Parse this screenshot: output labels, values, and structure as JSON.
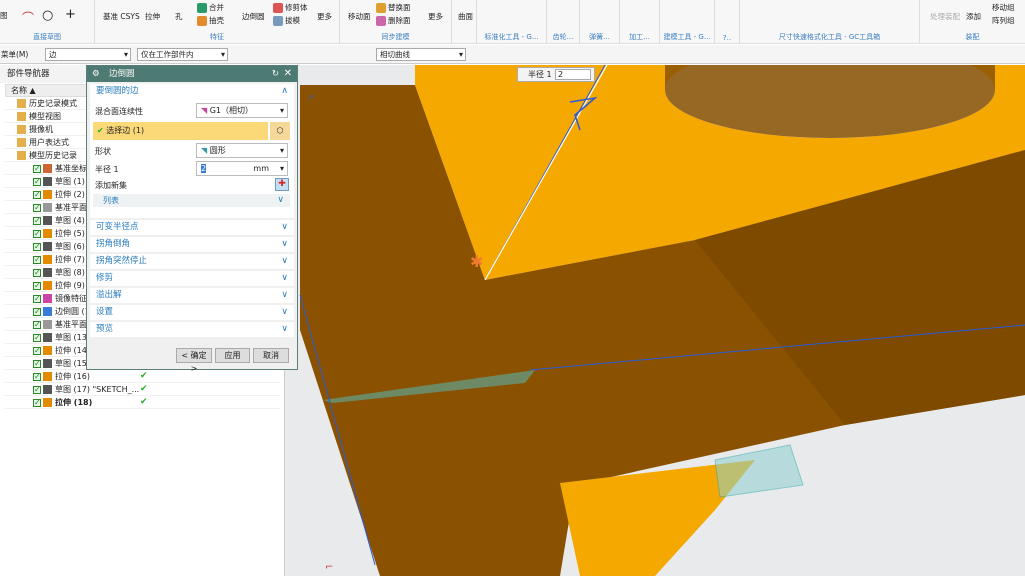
{
  "ribbon": {
    "groups": [
      {
        "label": "直接草图"
      },
      {
        "label": "特征"
      },
      {
        "label": "同步建模"
      },
      {
        "label": "标准化工具 - G..."
      },
      {
        "label": "齿轮..."
      },
      {
        "label": "弹簧..."
      },
      {
        "label": "加工..."
      },
      {
        "label": "建模工具 - G..."
      },
      {
        "label": "?.."
      },
      {
        "label": "尺寸快速格式化工具 - GC工具箱"
      },
      {
        "label": "装配"
      }
    ],
    "buttons": {
      "sketch": "图",
      "csys": "基准 CSYS",
      "extrude": "拉伸",
      "hole": "孔",
      "unite": "合并",
      "shell": "抽壳",
      "edge_blend": "边倒圆",
      "trim_body": "修剪体",
      "draft": "拔模",
      "more1": "更多",
      "move_face": "移动面",
      "replace_face": "替换面",
      "delete_face": "删除面",
      "more2": "更多",
      "surface": "曲面",
      "process_asm": "处理装配",
      "add": "添加",
      "move_comp": "移动组",
      "array_comp": "阵列组"
    }
  },
  "toolbar": {
    "menu": "菜单(M)",
    "filter": "边",
    "scope": "仅在工作部件内",
    "curve_rule": "相切曲线"
  },
  "navigator": {
    "title": "部件导航器",
    "column_name": "名称",
    "items": [
      {
        "label": "历史记录模式",
        "level": 0,
        "check": false
      },
      {
        "label": "模型视图",
        "level": 0,
        "check": false
      },
      {
        "label": "摄像机",
        "level": 0,
        "check": false
      },
      {
        "label": "用户表达式",
        "level": 0,
        "check": false
      },
      {
        "label": "模型历史记录",
        "level": 0,
        "check": false
      },
      {
        "label": "基准坐标",
        "level": 1,
        "check": true,
        "icon": "csys"
      },
      {
        "label": "草图 (1)",
        "level": 1,
        "check": true,
        "icon": "sketch"
      },
      {
        "label": "拉伸 (2)",
        "level": 1,
        "check": true,
        "icon": "extrude"
      },
      {
        "label": "基准平面",
        "level": 1,
        "check": true,
        "icon": "plane"
      },
      {
        "label": "草图 (4)",
        "level": 1,
        "check": true,
        "icon": "sketch"
      },
      {
        "label": "拉伸 (5)",
        "level": 1,
        "check": true,
        "icon": "extrude"
      },
      {
        "label": "草图 (6)",
        "level": 1,
        "check": true,
        "icon": "sketch"
      },
      {
        "label": "拉伸 (7)",
        "level": 1,
        "check": true,
        "icon": "extrude"
      },
      {
        "label": "草图 (8)",
        "level": 1,
        "check": true,
        "icon": "sketch"
      },
      {
        "label": "拉伸 (9)",
        "level": 1,
        "check": true,
        "icon": "extrude"
      },
      {
        "label": "镜像特征",
        "level": 1,
        "check": true,
        "icon": "mirror"
      },
      {
        "label": "边倒圆 (1",
        "level": 1,
        "check": true,
        "icon": "blend"
      },
      {
        "label": "基准平面",
        "level": 1,
        "check": true,
        "icon": "plane"
      },
      {
        "label": "草图 (13)",
        "level": 1,
        "check": true,
        "icon": "sketch"
      },
      {
        "label": "拉伸 (14)",
        "level": 1,
        "check": true,
        "icon": "extrude"
      },
      {
        "label": "草图 (15)",
        "level": 1,
        "check": true,
        "icon": "sketch"
      },
      {
        "label": "拉伸 (16)",
        "level": 1,
        "check": true,
        "icon": "extrude",
        "ok": true
      },
      {
        "label": "草图 (17) \"SKETCH_...",
        "level": 1,
        "check": true,
        "icon": "sketch",
        "ok": true
      },
      {
        "label": "拉伸 (18)",
        "level": 1,
        "check": true,
        "icon": "extrude",
        "ok": true,
        "bold": true
      }
    ]
  },
  "dialog": {
    "title": "边倒圆",
    "section_edges": "要倒圆的边",
    "continuity_label": "混合面连续性",
    "continuity_value": "G1（相切）",
    "select_edge": "选择边 (1)",
    "shape_label": "形状",
    "shape_value": "圆形",
    "radius_label": "半径 1",
    "radius_value": "2",
    "radius_unit": "mm",
    "add_set": "添加新集",
    "list": "列表",
    "sections": [
      "可变半径点",
      "拐角倒角",
      "拐角突然停止",
      "修剪",
      "溢出解",
      "设置",
      "预览"
    ],
    "ok": "< 确定 >",
    "apply": "应用",
    "cancel": "取消"
  },
  "viewport": {
    "radius_label": "半径 1",
    "radius_value": "2"
  },
  "colors": {
    "accent": "#4d7a72",
    "link": "#2a7dbf",
    "part_top": "#f5a800",
    "part_side": "#8a5200",
    "selection": "#fbd978"
  }
}
